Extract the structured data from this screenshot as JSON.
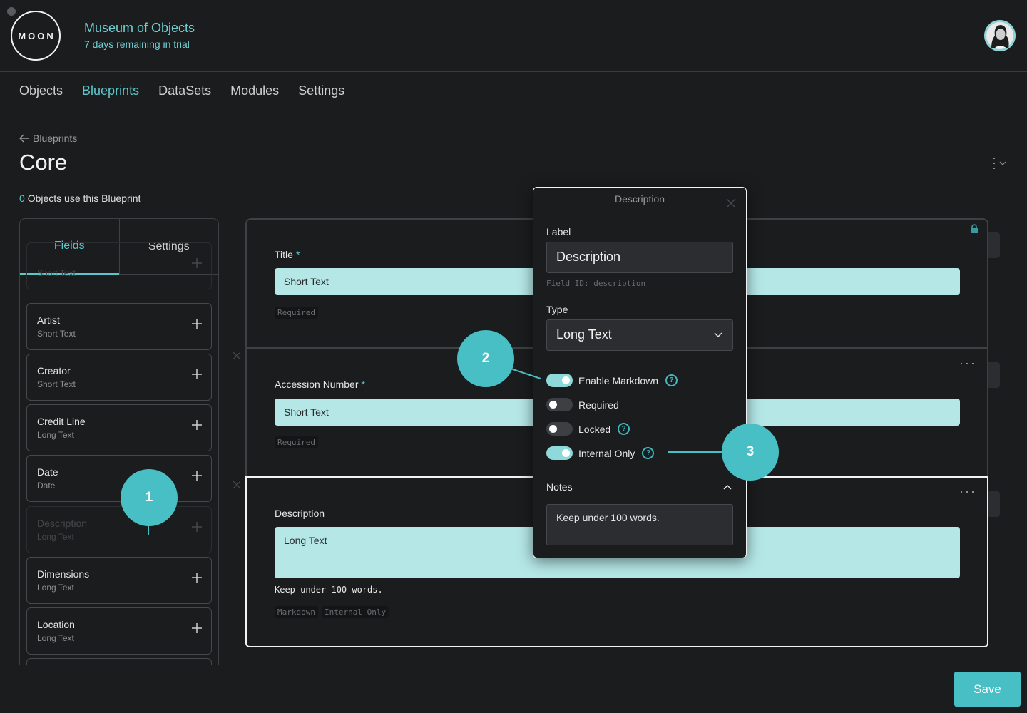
{
  "header": {
    "logo": "MOON",
    "org_name": "Museum of Objects",
    "trial_status": "7 days remaining in trial"
  },
  "nav": {
    "items": [
      {
        "label": "Objects",
        "active": false
      },
      {
        "label": "Blueprints",
        "active": true
      },
      {
        "label": "DataSets",
        "active": false
      },
      {
        "label": "Modules",
        "active": false
      },
      {
        "label": "Settings",
        "active": false
      }
    ]
  },
  "page": {
    "back_label": "Blueprints",
    "title": "Core",
    "usage_count": "0",
    "usage_text": "Objects use this Blueprint"
  },
  "left_panel": {
    "tabs": [
      {
        "label": "Fields",
        "active": true
      },
      {
        "label": "Settings",
        "active": false
      }
    ],
    "fields": [
      {
        "name": "",
        "type": "Short Text",
        "disabled": true
      },
      {
        "name": "Artist",
        "type": "Short Text",
        "disabled": false
      },
      {
        "name": "Creator",
        "type": "Short Text",
        "disabled": false
      },
      {
        "name": "Credit Line",
        "type": "Long Text",
        "disabled": false
      },
      {
        "name": "Date",
        "type": "Date",
        "disabled": false
      },
      {
        "name": "Description",
        "type": "Long Text",
        "disabled": true
      },
      {
        "name": "Dimensions",
        "type": "Long Text",
        "disabled": false
      },
      {
        "name": "Location",
        "type": "Long Text",
        "disabled": false
      }
    ]
  },
  "blueprint_fields": [
    {
      "label": "Title",
      "required": true,
      "placeholder": "Short Text",
      "tags": [
        "Required"
      ],
      "notes": "",
      "locked": true
    },
    {
      "label": "Accession Number",
      "required": true,
      "placeholder": "Short Text",
      "tags": [
        "Required"
      ],
      "notes": "",
      "locked": false
    },
    {
      "label": "Description",
      "required": false,
      "placeholder": "Long Text",
      "tags": [
        "Markdown",
        "Internal Only"
      ],
      "notes": "Keep under 100 words.",
      "locked": false
    }
  ],
  "modal": {
    "title": "Description",
    "label_caption": "Label",
    "label_value": "Description",
    "field_id": "Field ID: description",
    "type_caption": "Type",
    "type_value": "Long Text",
    "toggles": [
      {
        "label": "Enable Markdown",
        "on": true,
        "help": true
      },
      {
        "label": "Required",
        "on": false,
        "help": false
      },
      {
        "label": "Locked",
        "on": false,
        "help": true
      },
      {
        "label": "Internal Only",
        "on": true,
        "help": true
      }
    ],
    "notes_caption": "Notes",
    "notes_value": "Keep under 100 words."
  },
  "callouts": [
    "1",
    "2",
    "3"
  ],
  "save_label": "Save",
  "required_mark": "*",
  "help_glyph": "?",
  "colors": {
    "accent": "#48bfc4",
    "background": "#1b1c1e",
    "input_fill": "#b5e7e7"
  }
}
